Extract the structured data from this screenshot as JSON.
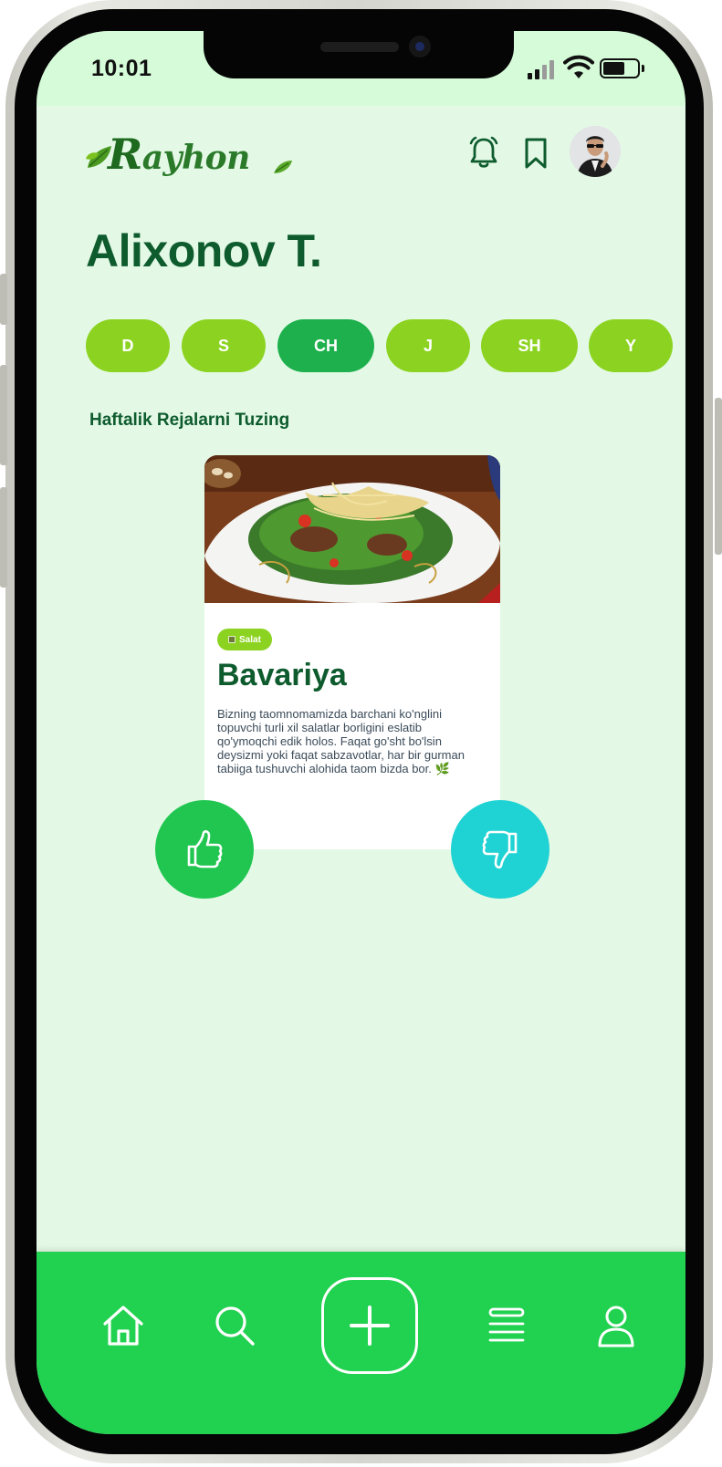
{
  "status_bar": {
    "time": "10:01"
  },
  "header": {
    "logo_text_initial": "R",
    "logo_text_rest": "ayhon",
    "notifications_icon": "bell-icon",
    "saved_icon": "bookmark-icon",
    "avatar_icon": "avatar"
  },
  "page": {
    "title": "Alixonov T.",
    "subtitle": "Haftalik Rejalarni Tuzing"
  },
  "days": [
    {
      "label": "D",
      "active": false
    },
    {
      "label": "S",
      "active": false
    },
    {
      "label": "CH",
      "active": true
    },
    {
      "label": "J",
      "active": false
    },
    {
      "label": "SH",
      "active": false
    },
    {
      "label": "Y",
      "active": false
    }
  ],
  "card": {
    "tag": "Salat",
    "name": "Bavariya",
    "description": "Bizning taomnomamizda barchani ko'nglini topuvchi turli xil salatlar borligini eslatib qo'ymoqchi edik holos. Faqat go'sht bo'lsin deysizmi yoki faqat sabzavotlar, har bir gurman tabiiga tushuvchi alohida taom bizda bor. 🌿"
  },
  "actions": {
    "like_icon": "thumbs-up-icon",
    "dislike_icon": "thumbs-down-icon"
  },
  "nav": {
    "items": [
      "home-icon",
      "search-icon",
      "plus-icon",
      "menu-list-icon",
      "profile-icon"
    ]
  },
  "colors": {
    "background": "#e3f9e5",
    "brand_dark": "#0e5b2e",
    "day_pill": "#8cd321",
    "day_pill_active": "#1db04c",
    "nav_bar": "#21d150",
    "like": "#21c651",
    "dislike": "#1fd2d3"
  }
}
